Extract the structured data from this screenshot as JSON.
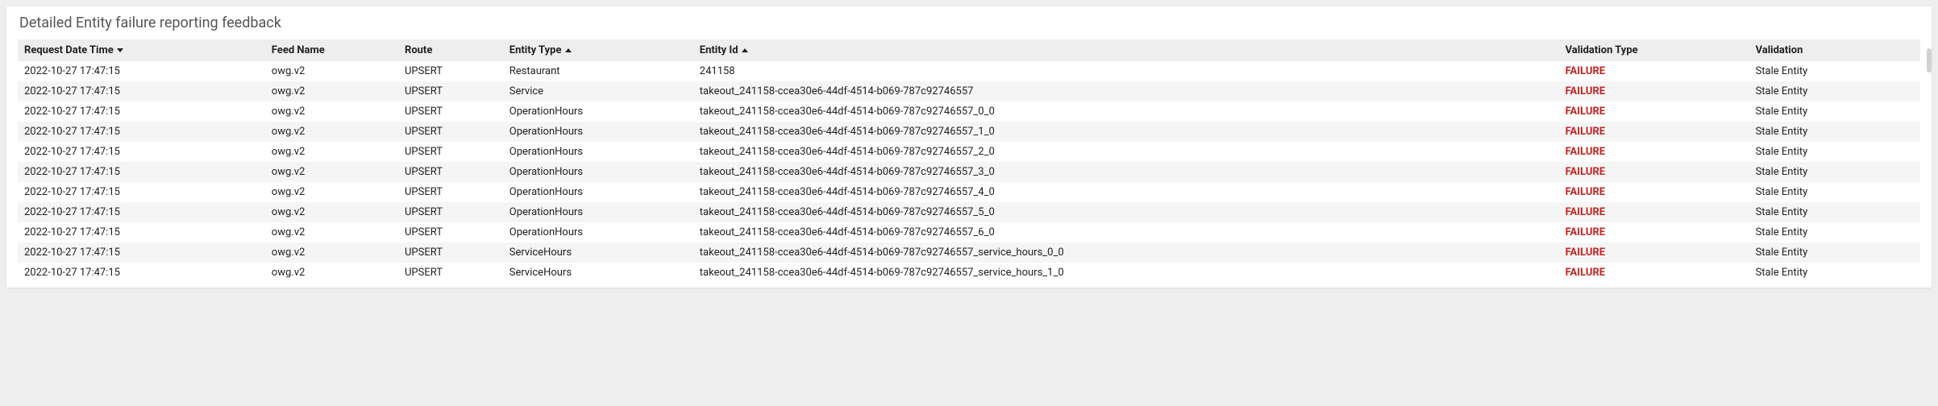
{
  "title": "Detailed Entity failure reporting feedback",
  "columns": {
    "request_dt": {
      "label": "Request Date Time",
      "sort": "desc"
    },
    "feed_name": {
      "label": "Feed Name"
    },
    "route": {
      "label": "Route"
    },
    "entity_type": {
      "label": "Entity Type",
      "sort": "asc"
    },
    "entity_id": {
      "label": "Entity Id",
      "sort": "asc"
    },
    "validation_type": {
      "label": "Validation Type"
    },
    "validation": {
      "label": "Validation"
    }
  },
  "failure_color": "#c5221f",
  "rows": [
    {
      "request_dt": "2022-10-27 17:47:15",
      "feed_name": "owg.v2",
      "route": "UPSERT",
      "entity_type": "Restaurant",
      "entity_id": "241158",
      "validation_type": "FAILURE",
      "validation": "Stale Entity"
    },
    {
      "request_dt": "2022-10-27 17:47:15",
      "feed_name": "owg.v2",
      "route": "UPSERT",
      "entity_type": "Service",
      "entity_id": "takeout_241158-ccea30e6-44df-4514-b069-787c92746557",
      "validation_type": "FAILURE",
      "validation": "Stale Entity"
    },
    {
      "request_dt": "2022-10-27 17:47:15",
      "feed_name": "owg.v2",
      "route": "UPSERT",
      "entity_type": "OperationHours",
      "entity_id": "takeout_241158-ccea30e6-44df-4514-b069-787c92746557_0_0",
      "validation_type": "FAILURE",
      "validation": "Stale Entity"
    },
    {
      "request_dt": "2022-10-27 17:47:15",
      "feed_name": "owg.v2",
      "route": "UPSERT",
      "entity_type": "OperationHours",
      "entity_id": "takeout_241158-ccea30e6-44df-4514-b069-787c92746557_1_0",
      "validation_type": "FAILURE",
      "validation": "Stale Entity"
    },
    {
      "request_dt": "2022-10-27 17:47:15",
      "feed_name": "owg.v2",
      "route": "UPSERT",
      "entity_type": "OperationHours",
      "entity_id": "takeout_241158-ccea30e6-44df-4514-b069-787c92746557_2_0",
      "validation_type": "FAILURE",
      "validation": "Stale Entity"
    },
    {
      "request_dt": "2022-10-27 17:47:15",
      "feed_name": "owg.v2",
      "route": "UPSERT",
      "entity_type": "OperationHours",
      "entity_id": "takeout_241158-ccea30e6-44df-4514-b069-787c92746557_3_0",
      "validation_type": "FAILURE",
      "validation": "Stale Entity"
    },
    {
      "request_dt": "2022-10-27 17:47:15",
      "feed_name": "owg.v2",
      "route": "UPSERT",
      "entity_type": "OperationHours",
      "entity_id": "takeout_241158-ccea30e6-44df-4514-b069-787c92746557_4_0",
      "validation_type": "FAILURE",
      "validation": "Stale Entity"
    },
    {
      "request_dt": "2022-10-27 17:47:15",
      "feed_name": "owg.v2",
      "route": "UPSERT",
      "entity_type": "OperationHours",
      "entity_id": "takeout_241158-ccea30e6-44df-4514-b069-787c92746557_5_0",
      "validation_type": "FAILURE",
      "validation": "Stale Entity"
    },
    {
      "request_dt": "2022-10-27 17:47:15",
      "feed_name": "owg.v2",
      "route": "UPSERT",
      "entity_type": "OperationHours",
      "entity_id": "takeout_241158-ccea30e6-44df-4514-b069-787c92746557_6_0",
      "validation_type": "FAILURE",
      "validation": "Stale Entity"
    },
    {
      "request_dt": "2022-10-27 17:47:15",
      "feed_name": "owg.v2",
      "route": "UPSERT",
      "entity_type": "ServiceHours",
      "entity_id": "takeout_241158-ccea30e6-44df-4514-b069-787c92746557_service_hours_0_0",
      "validation_type": "FAILURE",
      "validation": "Stale Entity"
    },
    {
      "request_dt": "2022-10-27 17:47:15",
      "feed_name": "owg.v2",
      "route": "UPSERT",
      "entity_type": "ServiceHours",
      "entity_id": "takeout_241158-ccea30e6-44df-4514-b069-787c92746557_service_hours_1_0",
      "validation_type": "FAILURE",
      "validation": "Stale Entity"
    }
  ]
}
